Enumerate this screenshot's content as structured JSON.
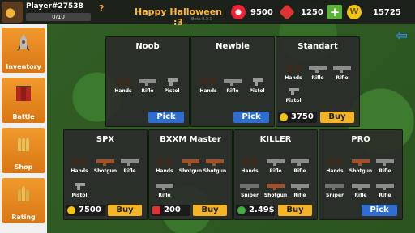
{
  "top": {
    "player_name": "Player#27538",
    "xp": "0/10",
    "help": "?",
    "title": "Happy Halloween :3",
    "version": "Beta 0.2.0",
    "candy": "9500",
    "gems": "1250",
    "plus": "+",
    "coins": "15725",
    "coin_glyph": "W"
  },
  "sidebar": [
    {
      "label": "Inventory"
    },
    {
      "label": "Battle"
    },
    {
      "label": "Shop"
    },
    {
      "label": "Rating"
    }
  ],
  "cards": [
    {
      "name": "Noob",
      "items": [
        "Hands",
        "Rifle",
        "Pistol"
      ],
      "action": "Pick"
    },
    {
      "name": "Newbie",
      "items": [
        "Hands",
        "Rifle",
        "Pistol"
      ],
      "action": "Pick"
    },
    {
      "name": "Standart",
      "items": [
        "Hands",
        "Rifle",
        "Rifle",
        "Pistol"
      ],
      "price": "3750",
      "action": "Buy"
    },
    {
      "name": "SPX",
      "items": [
        "Hands",
        "Shotgun",
        "Rifle",
        "Pistol"
      ],
      "price": "7500",
      "action": "Buy"
    },
    {
      "name": "BXXM Master",
      "items": [
        "Hands",
        "Shotgun",
        "Shotgun",
        "Rifle"
      ],
      "price": "200",
      "action": "Buy"
    },
    {
      "name": "KILLER",
      "items": [
        "Hands",
        "Rifle",
        "Rifle",
        "Sniper",
        "Shotgun",
        "Rifle"
      ],
      "price": "2.49$",
      "action": "Buy"
    },
    {
      "name": "PRO",
      "items": [
        "Hands",
        "Shotgun",
        "Rifle",
        "Sniper",
        "Rifle",
        "Rifle"
      ],
      "action": "Pick"
    }
  ],
  "colors": {
    "pick": "#2f6ed0",
    "buy": "#f4b425",
    "accent": "#f09a2e"
  }
}
